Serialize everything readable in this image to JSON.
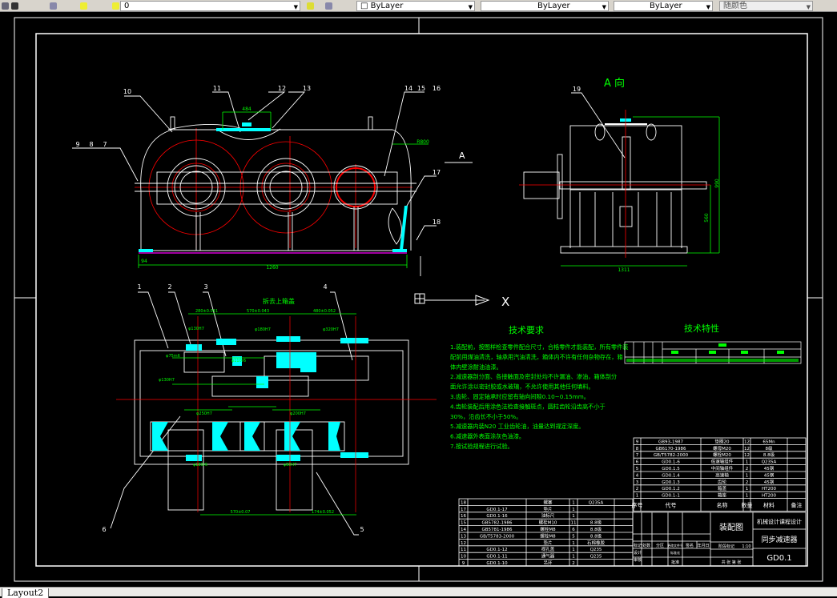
{
  "toolbar": {
    "layer_value": "0",
    "color_value": "ByLayer",
    "linetype_value": "ByLayer",
    "lineweight_value": "ByLayer",
    "plotstyle_value": "随颜色"
  },
  "tabs": [
    {
      "label": "Layout2",
      "active": true
    }
  ],
  "colors": {
    "background": "#000000",
    "outline": "#ffffff",
    "dimension": "#00ff00",
    "centerline": "#ff0000",
    "section": "#00ffff",
    "text": "#00ff00"
  },
  "front_view": {
    "balloons": [
      "10",
      "11",
      "12",
      "13",
      "14",
      "15",
      "16",
      "9",
      "8",
      "7",
      "17",
      "18"
    ],
    "dim_overall": "1260",
    "dim_top": "484",
    "dim_small": "94",
    "dim_radius": "R800",
    "arrow_label": "A"
  },
  "side_view": {
    "title": "A 向",
    "balloon": "19",
    "dim_width": "1311",
    "dim_height_total": "990",
    "dim_height_axis": "560"
  },
  "plan_view": {
    "title": "拆去上箱盖",
    "balloons": [
      "1",
      "2",
      "3",
      "4",
      "5",
      "6"
    ],
    "dim_top": [
      "280±0.041",
      "570±0.043",
      "480±0.052"
    ],
    "dim_bottom": [
      "570±0.07",
      "174±0.052"
    ],
    "fits": [
      "φ130H7",
      "φ180H7",
      "φ250H7",
      "φ320H7",
      "φ200H7",
      "φ110r6",
      "φ180r6",
      "φ90H7",
      "φ75m6"
    ]
  },
  "ucs": {
    "x_label": "X"
  },
  "tech_requirements": {
    "title": "技术要求",
    "lines": [
      "1.装配前，按图样检查零件配合尺寸，合格零件才能装配，所有零件装",
      "配前用煤油清洗，轴承用汽油清洗，箱体内不许有任何杂物存在，箱",
      "体内壁涂耐油油漆。",
      "2.减速器剖分面、各接触面及密封处均不许漏油、渗油，箱体剖分",
      "面允许涂以密封胶或水玻璃，不允许使用其他任何填料。",
      "3.齿轮、固定轴承时应留有轴向间隙0.10~0.15mm。",
      "4.齿轮装配后用涂色法检查接触斑点，圆柱齿轮沿齿高不小于",
      "30%，沿齿长不小于50%。",
      "5.减速器内装N20 工业齿轮油，油量达到规定深度。",
      "6.减速器外表面涂灰色油漆。",
      "7.按试验规程进行试验。"
    ]
  },
  "tech_characteristics": {
    "title": "技术特性"
  },
  "parts_upper": {
    "header": [
      "序号",
      "代号",
      "名称",
      "数量",
      "材料",
      "备注"
    ],
    "rows": [
      [
        "9",
        "GB93-1987",
        "垫圈20",
        "12",
        "65Mn",
        ""
      ],
      [
        "8",
        "GB6170-1986",
        "螺母M20",
        "12",
        "8级",
        ""
      ],
      [
        "7",
        "GB/T5782-2000",
        "螺栓M20",
        "12",
        "8.8级",
        ""
      ],
      [
        "6",
        "GD0.1-6",
        "低速轴组件",
        "1",
        "Q235A",
        ""
      ],
      [
        "5",
        "GD0.1.5",
        "中间轴组件",
        "2",
        "45钢",
        ""
      ],
      [
        "4",
        "GD0.1.4",
        "高速轴",
        "1",
        "45钢",
        ""
      ],
      [
        "3",
        "GD0.1.3",
        "齿轮",
        "2",
        "45钢",
        ""
      ],
      [
        "2",
        "GD0.1.2",
        "箱盖",
        "1",
        "HT200",
        ""
      ],
      [
        "1",
        "GD0.1-1",
        "箱座",
        "1",
        "HT200",
        ""
      ]
    ]
  },
  "parts_lower": {
    "rows": [
      [
        "18",
        "",
        "螺塞",
        "1",
        "Q235A",
        ""
      ],
      [
        "17",
        "GD0.1-17",
        "垫片",
        "1",
        "",
        ""
      ],
      [
        "16",
        "GD0.1-16",
        "油标尺",
        "1",
        "",
        ""
      ],
      [
        "15",
        "GB5782-1986",
        "螺栓M10",
        "11",
        "8.8级",
        ""
      ],
      [
        "14",
        "GB5781-1986",
        "螺栓M8",
        "6",
        "8.8级",
        ""
      ],
      [
        "13",
        "GB/T5783-2000",
        "螺栓M8",
        "5",
        "8.8级",
        ""
      ],
      [
        "12",
        "",
        "垫片",
        "1",
        "石棉橡胶",
        ""
      ],
      [
        "11",
        "GD0.1-12",
        "视孔盖",
        "1",
        "Q235",
        ""
      ],
      [
        "10",
        "GD0.1-11",
        "通气器",
        "1",
        "Q235",
        ""
      ],
      [
        "9",
        "GD0.1-10",
        "吊环",
        "2",
        "",
        ""
      ]
    ]
  },
  "title_block": {
    "drawing_type": "装配图",
    "school": "机械设计课程设计",
    "name": "同步减速器",
    "code": "GD0.1",
    "scale": "1:10",
    "sheet": "共 张 第 张",
    "labels": [
      "标记",
      "处数",
      "分区",
      "更改文件号",
      "签名",
      "年月日",
      "设计",
      "标准化",
      "审核",
      "工艺",
      "批准",
      "阶段标记",
      "重量",
      "比例"
    ]
  }
}
